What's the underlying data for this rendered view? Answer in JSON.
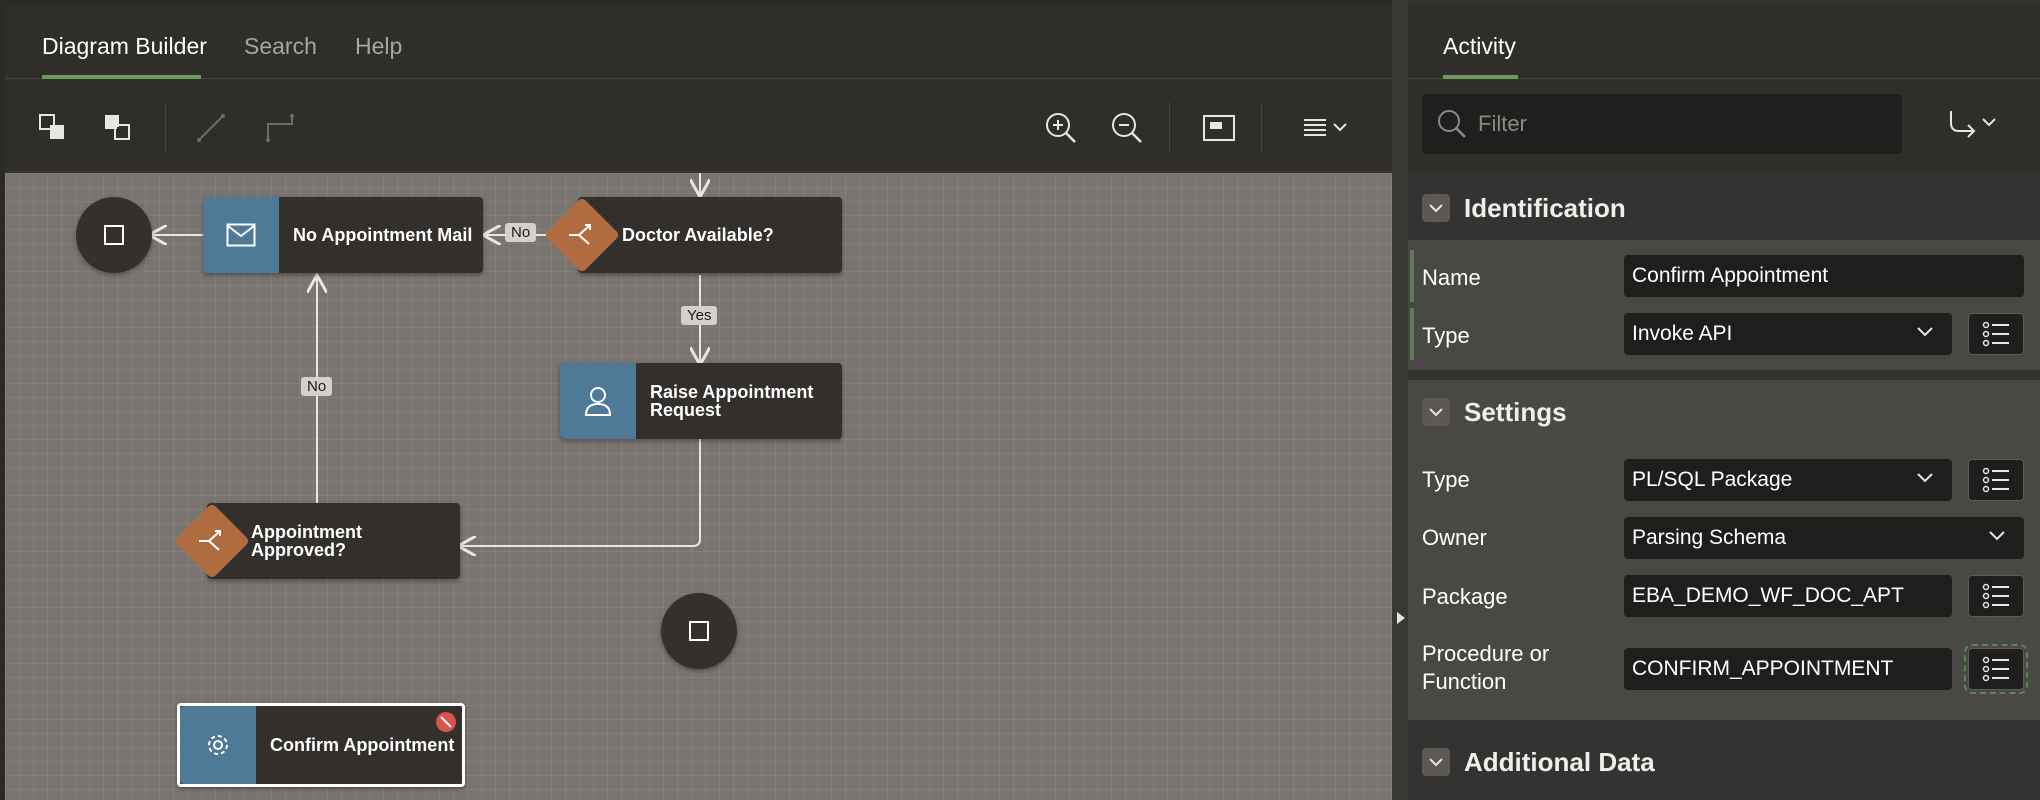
{
  "left": {
    "tabs": [
      {
        "label": "Diagram Builder",
        "active": true
      },
      {
        "label": "Search",
        "active": false
      },
      {
        "label": "Help",
        "active": false
      }
    ]
  },
  "canvas": {
    "nodes": {
      "no_appointment_mail": "No Appointment Mail",
      "doctor_available": "Doctor Available?",
      "raise_appointment": "Raise Appointment Request",
      "appointment_approved": "Appointment Approved?",
      "confirm_appointment": "Confirm Appointment"
    },
    "edge_labels": {
      "no_top": "No",
      "yes": "Yes",
      "no_left": "No"
    }
  },
  "right": {
    "tab": "Activity",
    "filter_placeholder": "Filter",
    "identification": {
      "title": "Identification",
      "name_label": "Name",
      "name_value": "Confirm Appointment",
      "type_label": "Type",
      "type_value": "Invoke API"
    },
    "settings": {
      "title": "Settings",
      "type_label": "Type",
      "type_value": "PL/SQL Package",
      "owner_label": "Owner",
      "owner_value": "Parsing Schema",
      "package_label": "Package",
      "package_value": "EBA_DEMO_WF_DOC_APT",
      "procedure_label_1": "Procedure or",
      "procedure_label_2": "Function",
      "procedure_value": "CONFIRM_APPOINTMENT"
    },
    "additional": {
      "title": "Additional Data"
    }
  },
  "colors": {
    "accent_green": "#6b9a5a",
    "task_blue": "#4f7a97",
    "gateway_orange": "#b06b3f",
    "error_red": "#d9534f"
  }
}
